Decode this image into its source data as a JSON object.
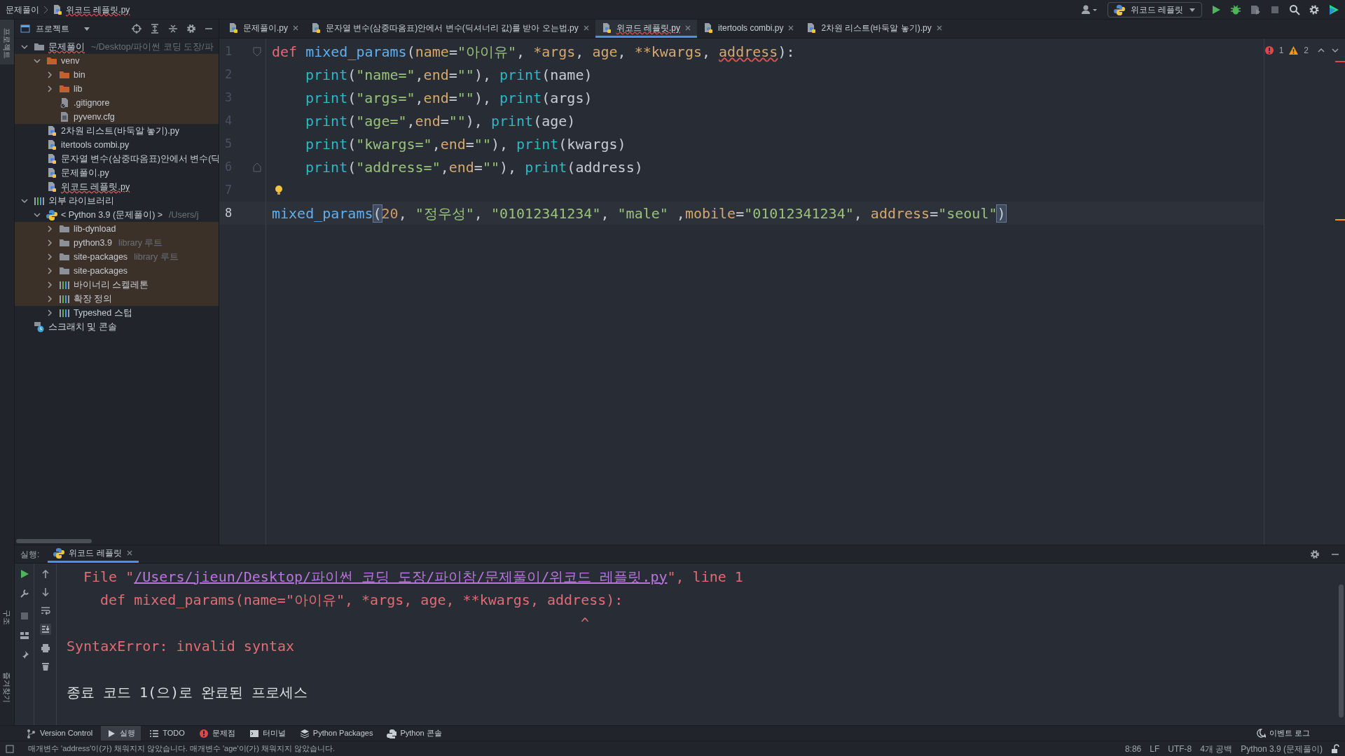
{
  "breadcrumb": [
    {
      "label": "문제풀이",
      "kind": "folder",
      "underlined": false
    },
    {
      "label": "위코드 레플릿.py",
      "kind": "python",
      "underlined": true
    }
  ],
  "toolbar": {
    "run_config": "위코드 레플릿"
  },
  "left_strip": {
    "top": [
      "프로젝트"
    ],
    "bottom": [
      "구조",
      "즐겨찾기"
    ]
  },
  "project_panel": {
    "title": "프로젝트",
    "tree": [
      {
        "label": "문제풀이",
        "hint": "~/Desktop/파이썬 코딩 도장/파",
        "kind": "folder",
        "expanded": true,
        "excluded": false,
        "underlined": true,
        "children": [
          {
            "label": "venv",
            "kind": "excluded-folder",
            "expanded": true,
            "excluded": true,
            "underlined": false,
            "children": [
              {
                "label": "bin",
                "kind": "excluded-folder",
                "expanded": false,
                "excluded": true,
                "underlined": false
              },
              {
                "label": "lib",
                "kind": "excluded-folder",
                "expanded": false,
                "excluded": true,
                "underlined": false
              },
              {
                "label": ".gitignore",
                "kind": "ignore-file",
                "excluded": true,
                "underlined": false
              },
              {
                "label": "pyvenv.cfg",
                "kind": "text-file",
                "excluded": true,
                "underlined": false
              }
            ]
          },
          {
            "label": "2차원 리스트(바둑알 놓기).py",
            "kind": "python",
            "excluded": false,
            "underlined": false
          },
          {
            "label": "itertools combi.py",
            "kind": "python",
            "excluded": false,
            "underlined": false
          },
          {
            "label": "문자열 변수(삼중따옴표)안에서 변수(딕",
            "kind": "python",
            "excluded": false,
            "underlined": false
          },
          {
            "label": "문제풀이.py",
            "kind": "python",
            "excluded": false,
            "underlined": false
          },
          {
            "label": "위코드 레플릿.py",
            "kind": "python",
            "excluded": false,
            "underlined": true
          }
        ]
      },
      {
        "label": "외부 라이브러리",
        "kind": "library",
        "expanded": true,
        "excluded": false,
        "underlined": false,
        "children": [
          {
            "label": "< Python 3.9 (문제풀이) >",
            "hint": "/Users/j",
            "kind": "sdk",
            "expanded": true,
            "excluded": false,
            "underlined": false,
            "children": [
              {
                "label": "lib-dynload",
                "kind": "folder",
                "expanded": false,
                "excluded": true,
                "underlined": false
              },
              {
                "label": "python3.9",
                "hint": "library 루트",
                "kind": "folder",
                "expanded": false,
                "excluded": true,
                "underlined": false
              },
              {
                "label": "site-packages",
                "hint": "library 루트",
                "kind": "folder",
                "expanded": false,
                "excluded": true,
                "underlined": false
              },
              {
                "label": "site-packages",
                "kind": "folder",
                "expanded": false,
                "excluded": true,
                "underlined": false
              },
              {
                "label": "바이너리 스켈레톤",
                "kind": "library",
                "expanded": false,
                "excluded": true,
                "underlined": false
              },
              {
                "label": "확장 정의",
                "kind": "library",
                "expanded": false,
                "excluded": true,
                "underlined": false
              },
              {
                "label": "Typeshed 스텁",
                "kind": "library",
                "expanded": false,
                "excluded": false,
                "underlined": false
              }
            ]
          }
        ]
      },
      {
        "label": "스크래치 및 콘솔",
        "kind": "scratch",
        "excluded": false,
        "underlined": false
      }
    ]
  },
  "tabs": [
    {
      "label": "문제풀이.py",
      "selected": false,
      "underlined": false
    },
    {
      "label": "문자열 변수(삼중따옴표)안에서 변수(딕셔너리 값)를 받아 오는법.py",
      "selected": false,
      "underlined": false
    },
    {
      "label": "위코드 레플릿.py",
      "selected": true,
      "underlined": true
    },
    {
      "label": "itertools combi.py",
      "selected": false,
      "underlined": false
    },
    {
      "label": "2차원 리스트(바둑알 놓기).py",
      "selected": false,
      "underlined": false
    }
  ],
  "inspections": {
    "errors": "1",
    "warnings": "2"
  },
  "editor": {
    "lines": [
      {
        "number": "1",
        "fold_start": true,
        "tokens": [
          {
            "t": "def ",
            "kind": "keyword"
          },
          {
            "t": "mixed_params",
            "kind": "function"
          },
          {
            "t": "(",
            "kind": "plain"
          },
          {
            "t": "name",
            "kind": "param"
          },
          {
            "t": "=",
            "kind": "plain"
          },
          {
            "t": "\"아이유\"",
            "kind": "string"
          },
          {
            "t": ", ",
            "kind": "plain"
          },
          {
            "t": "*args",
            "kind": "param"
          },
          {
            "t": ", ",
            "kind": "plain"
          },
          {
            "t": "age",
            "kind": "param"
          },
          {
            "t": ", ",
            "kind": "plain"
          },
          {
            "t": "**kwargs",
            "kind": "param"
          },
          {
            "t": ", ",
            "kind": "plain"
          },
          {
            "t": "address",
            "kind": "error"
          },
          {
            "t": "):",
            "kind": "plain"
          }
        ]
      },
      {
        "number": "2",
        "indented": true,
        "tokens": [
          {
            "t": "print",
            "kind": "builtin"
          },
          {
            "t": "(",
            "kind": "plain"
          },
          {
            "t": "\"name=\"",
            "kind": "string"
          },
          {
            "t": ",",
            "kind": "plain"
          },
          {
            "t": "end",
            "kind": "param"
          },
          {
            "t": "=",
            "kind": "plain"
          },
          {
            "t": "\"\"",
            "kind": "string"
          },
          {
            "t": "), ",
            "kind": "plain"
          },
          {
            "t": "print",
            "kind": "builtin"
          },
          {
            "t": "(name)",
            "kind": "plain"
          }
        ]
      },
      {
        "number": "3",
        "indented": true,
        "tokens": [
          {
            "t": "print",
            "kind": "builtin"
          },
          {
            "t": "(",
            "kind": "plain"
          },
          {
            "t": "\"args=\"",
            "kind": "string"
          },
          {
            "t": ",",
            "kind": "plain"
          },
          {
            "t": "end",
            "kind": "param"
          },
          {
            "t": "=",
            "kind": "plain"
          },
          {
            "t": "\"\"",
            "kind": "string"
          },
          {
            "t": "), ",
            "kind": "plain"
          },
          {
            "t": "print",
            "kind": "builtin"
          },
          {
            "t": "(args)",
            "kind": "plain"
          }
        ]
      },
      {
        "number": "4",
        "indented": true,
        "tokens": [
          {
            "t": "print",
            "kind": "builtin"
          },
          {
            "t": "(",
            "kind": "plain"
          },
          {
            "t": "\"age=\"",
            "kind": "string"
          },
          {
            "t": ",",
            "kind": "plain"
          },
          {
            "t": "end",
            "kind": "param"
          },
          {
            "t": "=",
            "kind": "plain"
          },
          {
            "t": "\"\"",
            "kind": "string"
          },
          {
            "t": "), ",
            "kind": "plain"
          },
          {
            "t": "print",
            "kind": "builtin"
          },
          {
            "t": "(age)",
            "kind": "plain"
          }
        ]
      },
      {
        "number": "5",
        "indented": true,
        "tokens": [
          {
            "t": "print",
            "kind": "builtin"
          },
          {
            "t": "(",
            "kind": "plain"
          },
          {
            "t": "\"kwargs=\"",
            "kind": "string"
          },
          {
            "t": ",",
            "kind": "plain"
          },
          {
            "t": "end",
            "kind": "param"
          },
          {
            "t": "=",
            "kind": "plain"
          },
          {
            "t": "\"\"",
            "kind": "string"
          },
          {
            "t": "), ",
            "kind": "plain"
          },
          {
            "t": "print",
            "kind": "builtin"
          },
          {
            "t": "(kwargs)",
            "kind": "plain"
          }
        ]
      },
      {
        "number": "6",
        "fold_end": true,
        "indented": true,
        "tokens": [
          {
            "t": "print",
            "kind": "builtin"
          },
          {
            "t": "(",
            "kind": "plain"
          },
          {
            "t": "\"address=\"",
            "kind": "string"
          },
          {
            "t": ",",
            "kind": "plain"
          },
          {
            "t": "end",
            "kind": "param"
          },
          {
            "t": "=",
            "kind": "plain"
          },
          {
            "t": "\"\"",
            "kind": "string"
          },
          {
            "t": "), ",
            "kind": "plain"
          },
          {
            "t": "print",
            "kind": "builtin"
          },
          {
            "t": "(address)",
            "kind": "plain"
          }
        ]
      },
      {
        "number": "7",
        "bulb": true
      },
      {
        "number": "8",
        "current": true,
        "tokens": [
          {
            "t": "mixed_params",
            "kind": "function"
          },
          {
            "t": "(",
            "kind": "bracket"
          },
          {
            "t": "20",
            "kind": "number"
          },
          {
            "t": ", ",
            "kind": "plain"
          },
          {
            "t": "\"정우성\"",
            "kind": "string"
          },
          {
            "t": ", ",
            "kind": "plain"
          },
          {
            "t": "\"01012341234\"",
            "kind": "string"
          },
          {
            "t": ", ",
            "kind": "plain"
          },
          {
            "t": "\"male\"",
            "kind": "string"
          },
          {
            "t": " ,",
            "kind": "plain"
          },
          {
            "t": "mobile",
            "kind": "param"
          },
          {
            "t": "=",
            "kind": "plain"
          },
          {
            "t": "\"01012341234\"",
            "kind": "string"
          },
          {
            "t": ", ",
            "kind": "plain"
          },
          {
            "t": "address",
            "kind": "param"
          },
          {
            "t": "=",
            "kind": "plain"
          },
          {
            "t": "\"seoul\"",
            "kind": "string"
          },
          {
            "t": ")",
            "kind": "bracket"
          }
        ]
      }
    ]
  },
  "run_panel": {
    "label": "실행:",
    "tab": "위코드 레플릿",
    "output": [
      {
        "kind": "trace",
        "segments": [
          {
            "t": "File \"",
            "link": false
          },
          {
            "t": "/Users/jieun/Desktop/파이썬 코딩 도장/파이참/문제풀이/위코드 레플릿.py",
            "link": true
          },
          {
            "t": "\", line 1",
            "link": false
          }
        ]
      },
      {
        "kind": "source",
        "segments": [
          {
            "t": "def mixed_params(name=\"아이유\", *args, age, **kwargs, address):",
            "link": false
          }
        ]
      },
      {
        "kind": "caret",
        "segments": [
          {
            "t": "^",
            "link": false
          }
        ]
      },
      {
        "kind": "error",
        "segments": [
          {
            "t": "SyntaxError: invalid syntax",
            "link": false
          }
        ]
      },
      {
        "kind": "exit",
        "segments": [
          {
            "t": "종료 코드 1(으)로 완료된 프로세스",
            "link": false
          }
        ]
      }
    ]
  },
  "tool_tabs": [
    {
      "label": "Version Control",
      "kind": "vcs",
      "selected": false
    },
    {
      "label": "실행",
      "kind": "run",
      "selected": true
    },
    {
      "label": "TODO",
      "kind": "todo",
      "selected": false
    },
    {
      "label": "문제점",
      "kind": "problems",
      "selected": false
    },
    {
      "label": "터미널",
      "kind": "terminal",
      "selected": false
    },
    {
      "label": "Python Packages",
      "kind": "packages",
      "selected": false
    },
    {
      "label": "Python 콘솔",
      "kind": "console",
      "selected": false
    }
  ],
  "event_log": "이벤트 로그",
  "status_bar": {
    "message": "매개변수 'address'이(가) 채워지지 않았습니다. 매개변수 'age'이(가) 채워지지 않았습니다.",
    "items": [
      "8:86",
      "LF",
      "UTF-8",
      "4개 공백",
      "Python 3.9 (문제풀이)"
    ]
  }
}
